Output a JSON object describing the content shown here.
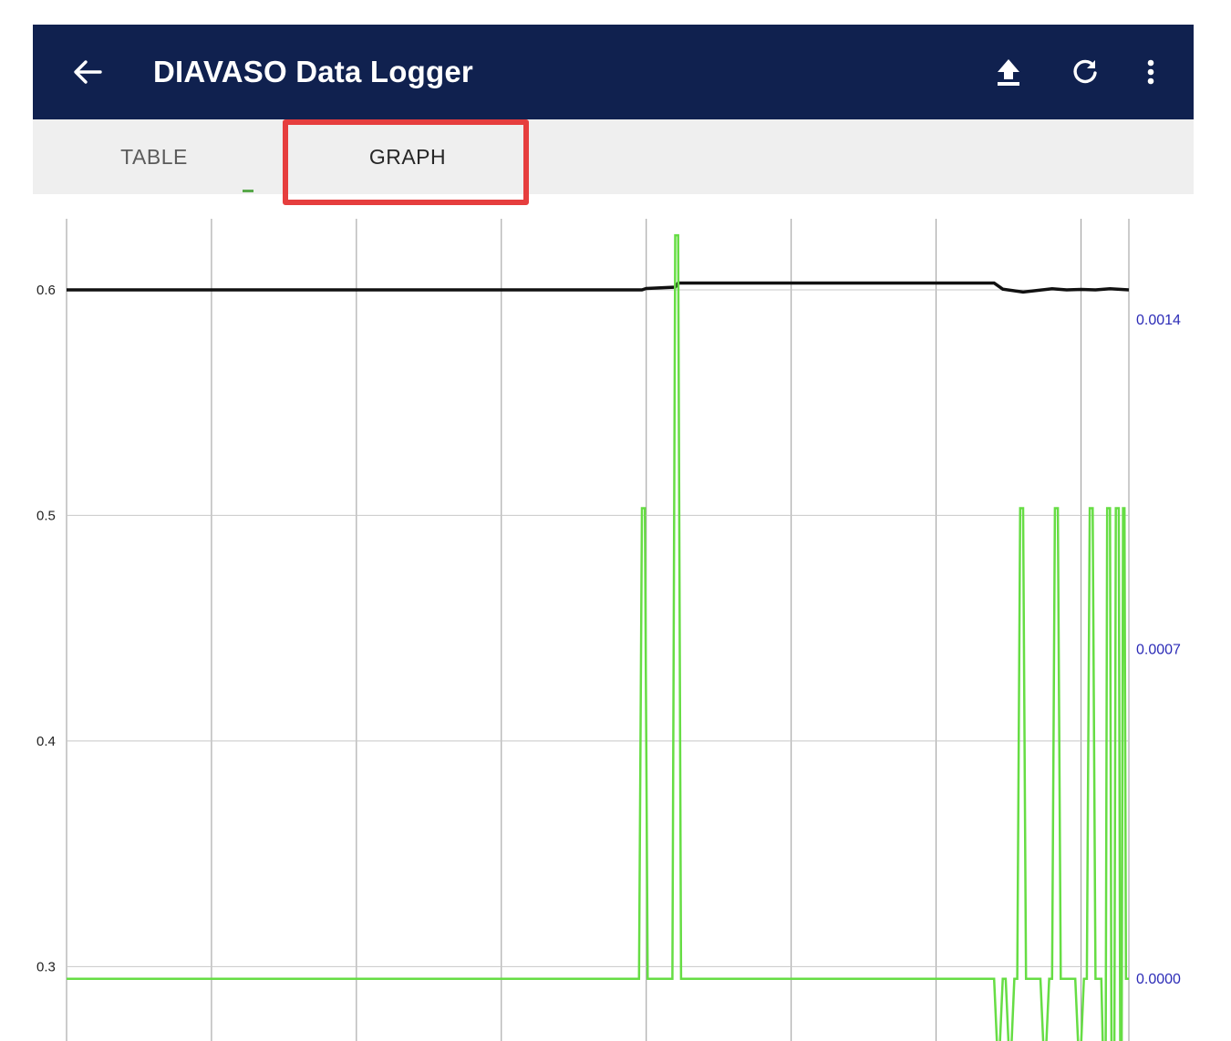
{
  "app_bar": {
    "title": "DIAVASO Data Logger",
    "background": "#10214f",
    "icons": [
      "arrow-back-icon",
      "upload-icon",
      "refresh-icon",
      "more-vert-icon"
    ]
  },
  "tabs": [
    {
      "label": "TABLE",
      "selected": false
    },
    {
      "label": "GRAPH",
      "selected": true
    }
  ],
  "highlight_color": "#e63e3e",
  "chart_data": {
    "type": "line",
    "grid": true,
    "left_axis": {
      "range": [
        0.267,
        0.6315
      ],
      "ticks": [
        "0.6",
        "0.5",
        "0.4",
        "0.3"
      ]
    },
    "right_axis": {
      "range": [
        -0.000132,
        0.001615
      ],
      "ticks": [
        "0.0014",
        "0.0007",
        "0.0000"
      ],
      "color": "#2b2bb7"
    },
    "x_range": [
      0,
      7.33
    ],
    "series": [
      {
        "axis": "left",
        "color": "#111111",
        "points": [
          [
            0,
            0.6
          ],
          [
            3.97,
            0.6
          ],
          [
            4.0,
            0.6006
          ],
          [
            4.2,
            0.6012
          ],
          [
            4.22,
            0.603
          ],
          [
            6.4,
            0.603
          ],
          [
            6.46,
            0.6003
          ],
          [
            6.6,
            0.599
          ],
          [
            6.8,
            0.6005
          ],
          [
            6.9,
            0.6
          ],
          [
            7.0,
            0.6002
          ],
          [
            7.1,
            0.6
          ],
          [
            7.2,
            0.6005
          ],
          [
            7.33,
            0.6
          ]
        ]
      },
      {
        "axis": "right",
        "color": "#66dd44",
        "points": [
          [
            0,
            0.0
          ],
          [
            3.95,
            0.0
          ],
          [
            3.97,
            0.001
          ],
          [
            3.99,
            0.001
          ],
          [
            4.01,
            0.0
          ],
          [
            4.18,
            0.0
          ],
          [
            4.2,
            0.00158
          ],
          [
            4.22,
            0.00158
          ],
          [
            4.24,
            0.0
          ],
          [
            6.4,
            0.0
          ],
          [
            6.42,
            -0.00014
          ],
          [
            6.44,
            -0.00014
          ],
          [
            6.46,
            0.0
          ],
          [
            6.48,
            0.0
          ],
          [
            6.5,
            -0.00014
          ],
          [
            6.52,
            -0.00014
          ],
          [
            6.54,
            0.0
          ],
          [
            6.56,
            0.0
          ],
          [
            6.58,
            0.001
          ],
          [
            6.6,
            0.001
          ],
          [
            6.62,
            0.0
          ],
          [
            6.72,
            0.0
          ],
          [
            6.74,
            -0.00014
          ],
          [
            6.76,
            -0.00014
          ],
          [
            6.78,
            0.0
          ],
          [
            6.8,
            0.0
          ],
          [
            6.82,
            0.001
          ],
          [
            6.84,
            0.001
          ],
          [
            6.86,
            0.0
          ],
          [
            6.96,
            0.0
          ],
          [
            6.98,
            -0.00014
          ],
          [
            7.0,
            -0.00014
          ],
          [
            7.02,
            0.0
          ],
          [
            7.04,
            0.0
          ],
          [
            7.06,
            0.001
          ],
          [
            7.08,
            0.001
          ],
          [
            7.1,
            0.0
          ],
          [
            7.14,
            0.0
          ],
          [
            7.15,
            -0.00014
          ],
          [
            7.17,
            -0.00014
          ],
          [
            7.18,
            0.001
          ],
          [
            7.2,
            0.001
          ],
          [
            7.21,
            -0.00014
          ],
          [
            7.23,
            -0.00014
          ],
          [
            7.24,
            0.001
          ],
          [
            7.26,
            0.001
          ],
          [
            7.27,
            -0.00014
          ],
          [
            7.28,
            -0.00014
          ],
          [
            7.29,
            0.001
          ],
          [
            7.3,
            0.001
          ],
          [
            7.31,
            0.0
          ],
          [
            7.33,
            0.0
          ]
        ]
      }
    ]
  }
}
